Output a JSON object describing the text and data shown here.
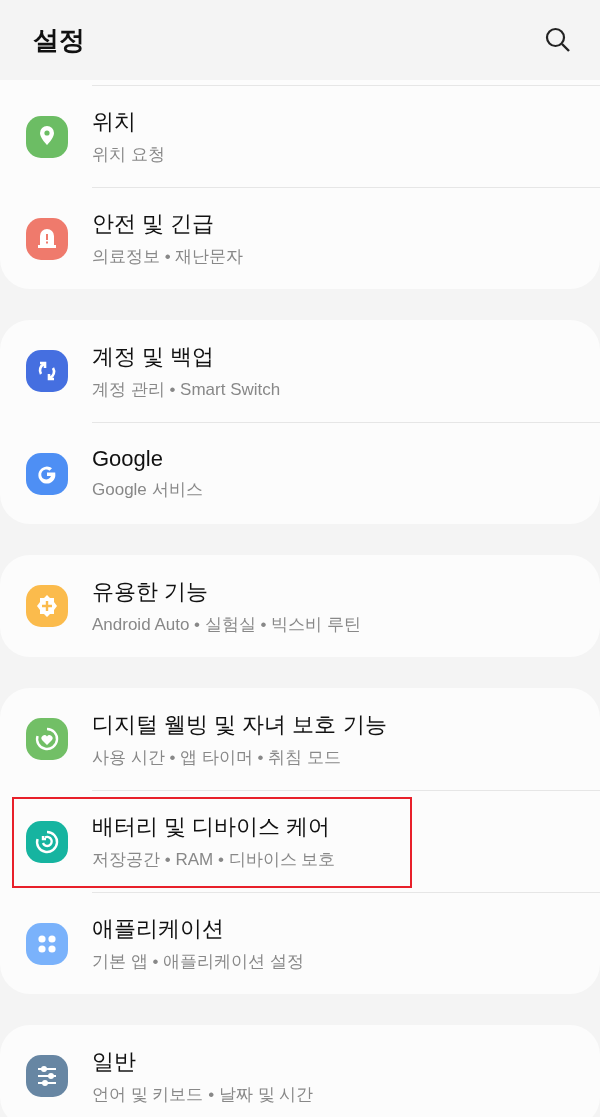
{
  "header": {
    "title": "설정"
  },
  "groups": [
    {
      "clipped_top": true,
      "items": [
        {
          "kind": "location",
          "color": "#6cbd64",
          "title": "위치",
          "subtitle": "위치 요청",
          "highlighted": false
        },
        {
          "kind": "alert",
          "color": "#ef7a6c",
          "title": "안전 및 긴급",
          "subtitle": "의료정보 • 재난문자",
          "highlighted": false
        }
      ]
    },
    {
      "clipped_top": false,
      "items": [
        {
          "kind": "sync",
          "color": "#456fe0",
          "title": "계정 및 백업",
          "subtitle": "계정 관리 • Smart Switch",
          "highlighted": false
        },
        {
          "kind": "google",
          "color": "#4e8ff4",
          "title": "Google",
          "subtitle": "Google 서비스",
          "highlighted": false
        }
      ]
    },
    {
      "clipped_top": false,
      "items": [
        {
          "kind": "gear-plus",
          "color": "#fbbb4c",
          "title": "유용한 기능",
          "subtitle": "Android Auto • 실험실 • 빅스비 루틴",
          "highlighted": false
        }
      ]
    },
    {
      "clipped_top": false,
      "items": [
        {
          "kind": "heart-ring",
          "color": "#72bf66",
          "title": "디지털 웰빙 및 자녀 보호 기능",
          "subtitle": "사용 시간 • 앱 타이머 • 취침 모드",
          "highlighted": false
        },
        {
          "kind": "care-ring",
          "color": "#16b4a0",
          "title": "배터리 및 디바이스 케어",
          "subtitle": "저장공간 • RAM • 디바이스 보호",
          "highlighted": true
        },
        {
          "kind": "dots",
          "color": "#7ab2fb",
          "title": "애플리케이션",
          "subtitle": "기본 앱 • 애플리케이션 설정",
          "highlighted": false
        }
      ]
    },
    {
      "clipped_top": false,
      "items": [
        {
          "kind": "sliders",
          "color": "#6786a3",
          "title": "일반",
          "subtitle": "언어 및 키보드 • 날짜 및 시간",
          "highlighted": false
        }
      ]
    }
  ]
}
